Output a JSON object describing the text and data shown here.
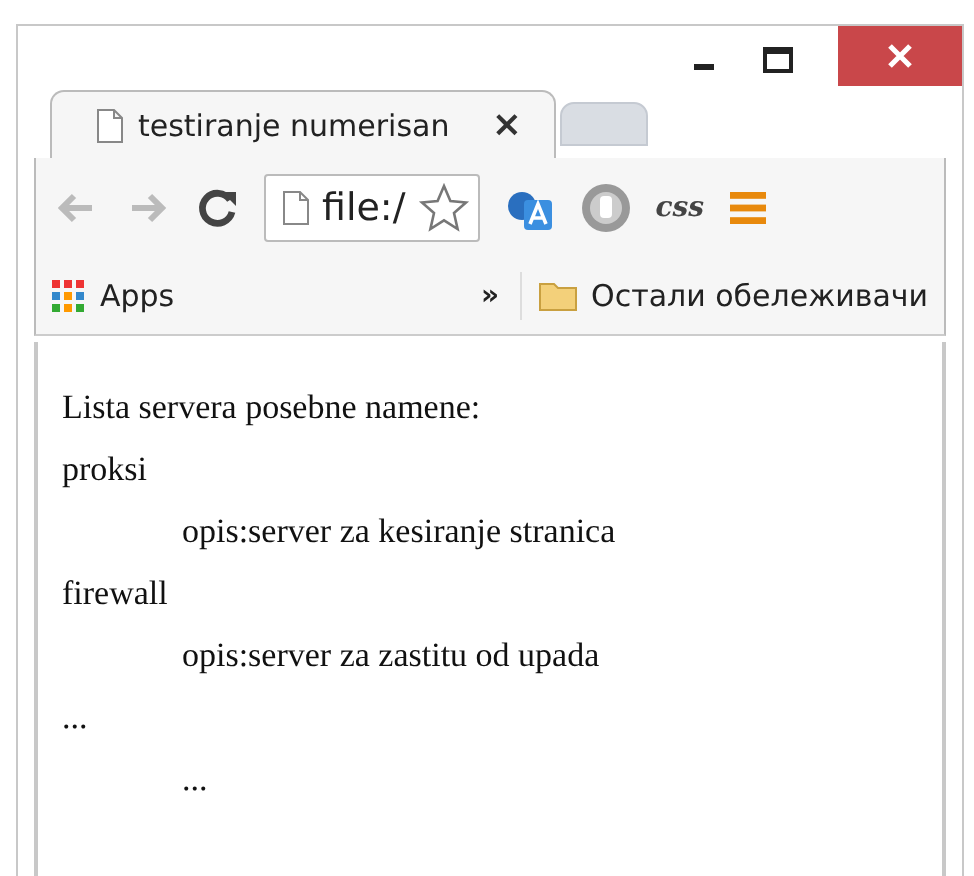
{
  "tabs": [
    {
      "title": "testiranje numerisan",
      "selected": true
    },
    {
      "selected": false
    }
  ],
  "close_tab": "×",
  "address_bar": {
    "value": "file:/"
  },
  "toolbar": {
    "css_button": "css"
  },
  "bookmarks_bar": {
    "apps": "Apps",
    "overflow": "»",
    "folder": "Остали обележивачи"
  },
  "content": {
    "heading": "Lista servera posebne namene:",
    "items": [
      {
        "term": "proksi",
        "description": "opis:server za kesiranje stranica"
      },
      {
        "term": "firewall",
        "description": "opis:server za zastitu od upada"
      },
      {
        "term": "...",
        "description": "..."
      }
    ]
  }
}
